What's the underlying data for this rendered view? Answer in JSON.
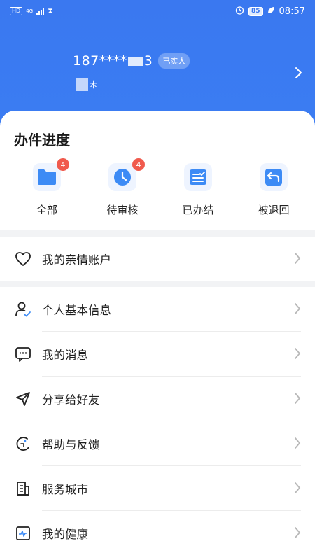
{
  "status_bar": {
    "hd": "HD",
    "network": "4G",
    "battery": "85",
    "time": "08:57"
  },
  "user": {
    "phone_prefix": "187****",
    "phone_suffix": "3",
    "verified_label": "已实人",
    "name_tail": "木"
  },
  "progress": {
    "title": "办件进度",
    "items": [
      {
        "label": "全部",
        "badge": "4",
        "icon": "folder-icon"
      },
      {
        "label": "待审核",
        "badge": "4",
        "icon": "clock-icon"
      },
      {
        "label": "已办结",
        "icon": "checklist-icon"
      },
      {
        "label": "被退回",
        "icon": "return-icon"
      }
    ]
  },
  "menu_single": {
    "label": "我的亲情账户",
    "icon": "heart-icon"
  },
  "menu": [
    {
      "label": "个人基本信息",
      "icon": "user-check-icon"
    },
    {
      "label": "我的消息",
      "icon": "message-icon"
    },
    {
      "label": "分享给好友",
      "icon": "share-icon"
    },
    {
      "label": "帮助与反馈",
      "icon": "help-icon"
    },
    {
      "label": "服务城市",
      "icon": "city-icon"
    },
    {
      "label": "我的健康",
      "icon": "health-icon"
    }
  ],
  "colors": {
    "primary": "#3a78f0",
    "badge": "#f05a4d",
    "icon_blue": "#3d8bf5"
  }
}
